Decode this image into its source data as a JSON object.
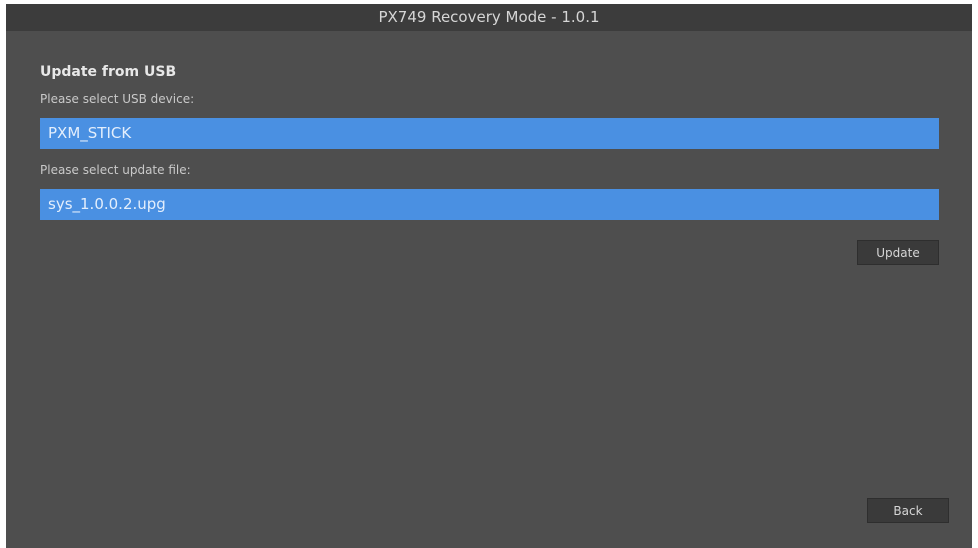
{
  "window": {
    "title": "PX749 Recovery Mode - 1.0.1"
  },
  "usb_update": {
    "heading": "Update from USB",
    "device_label": "Please select USB device:",
    "selected_device": "PXM_STICK",
    "file_label": "Please select update file:",
    "selected_file": "sys_1.0.0.2.upg",
    "update_button": "Update"
  },
  "footer": {
    "back_button": "Back"
  },
  "colors": {
    "background": "#4e4e4e",
    "titlebar": "#3c3c3c",
    "selection": "#4a90e2",
    "button": "#3a3a3a"
  }
}
